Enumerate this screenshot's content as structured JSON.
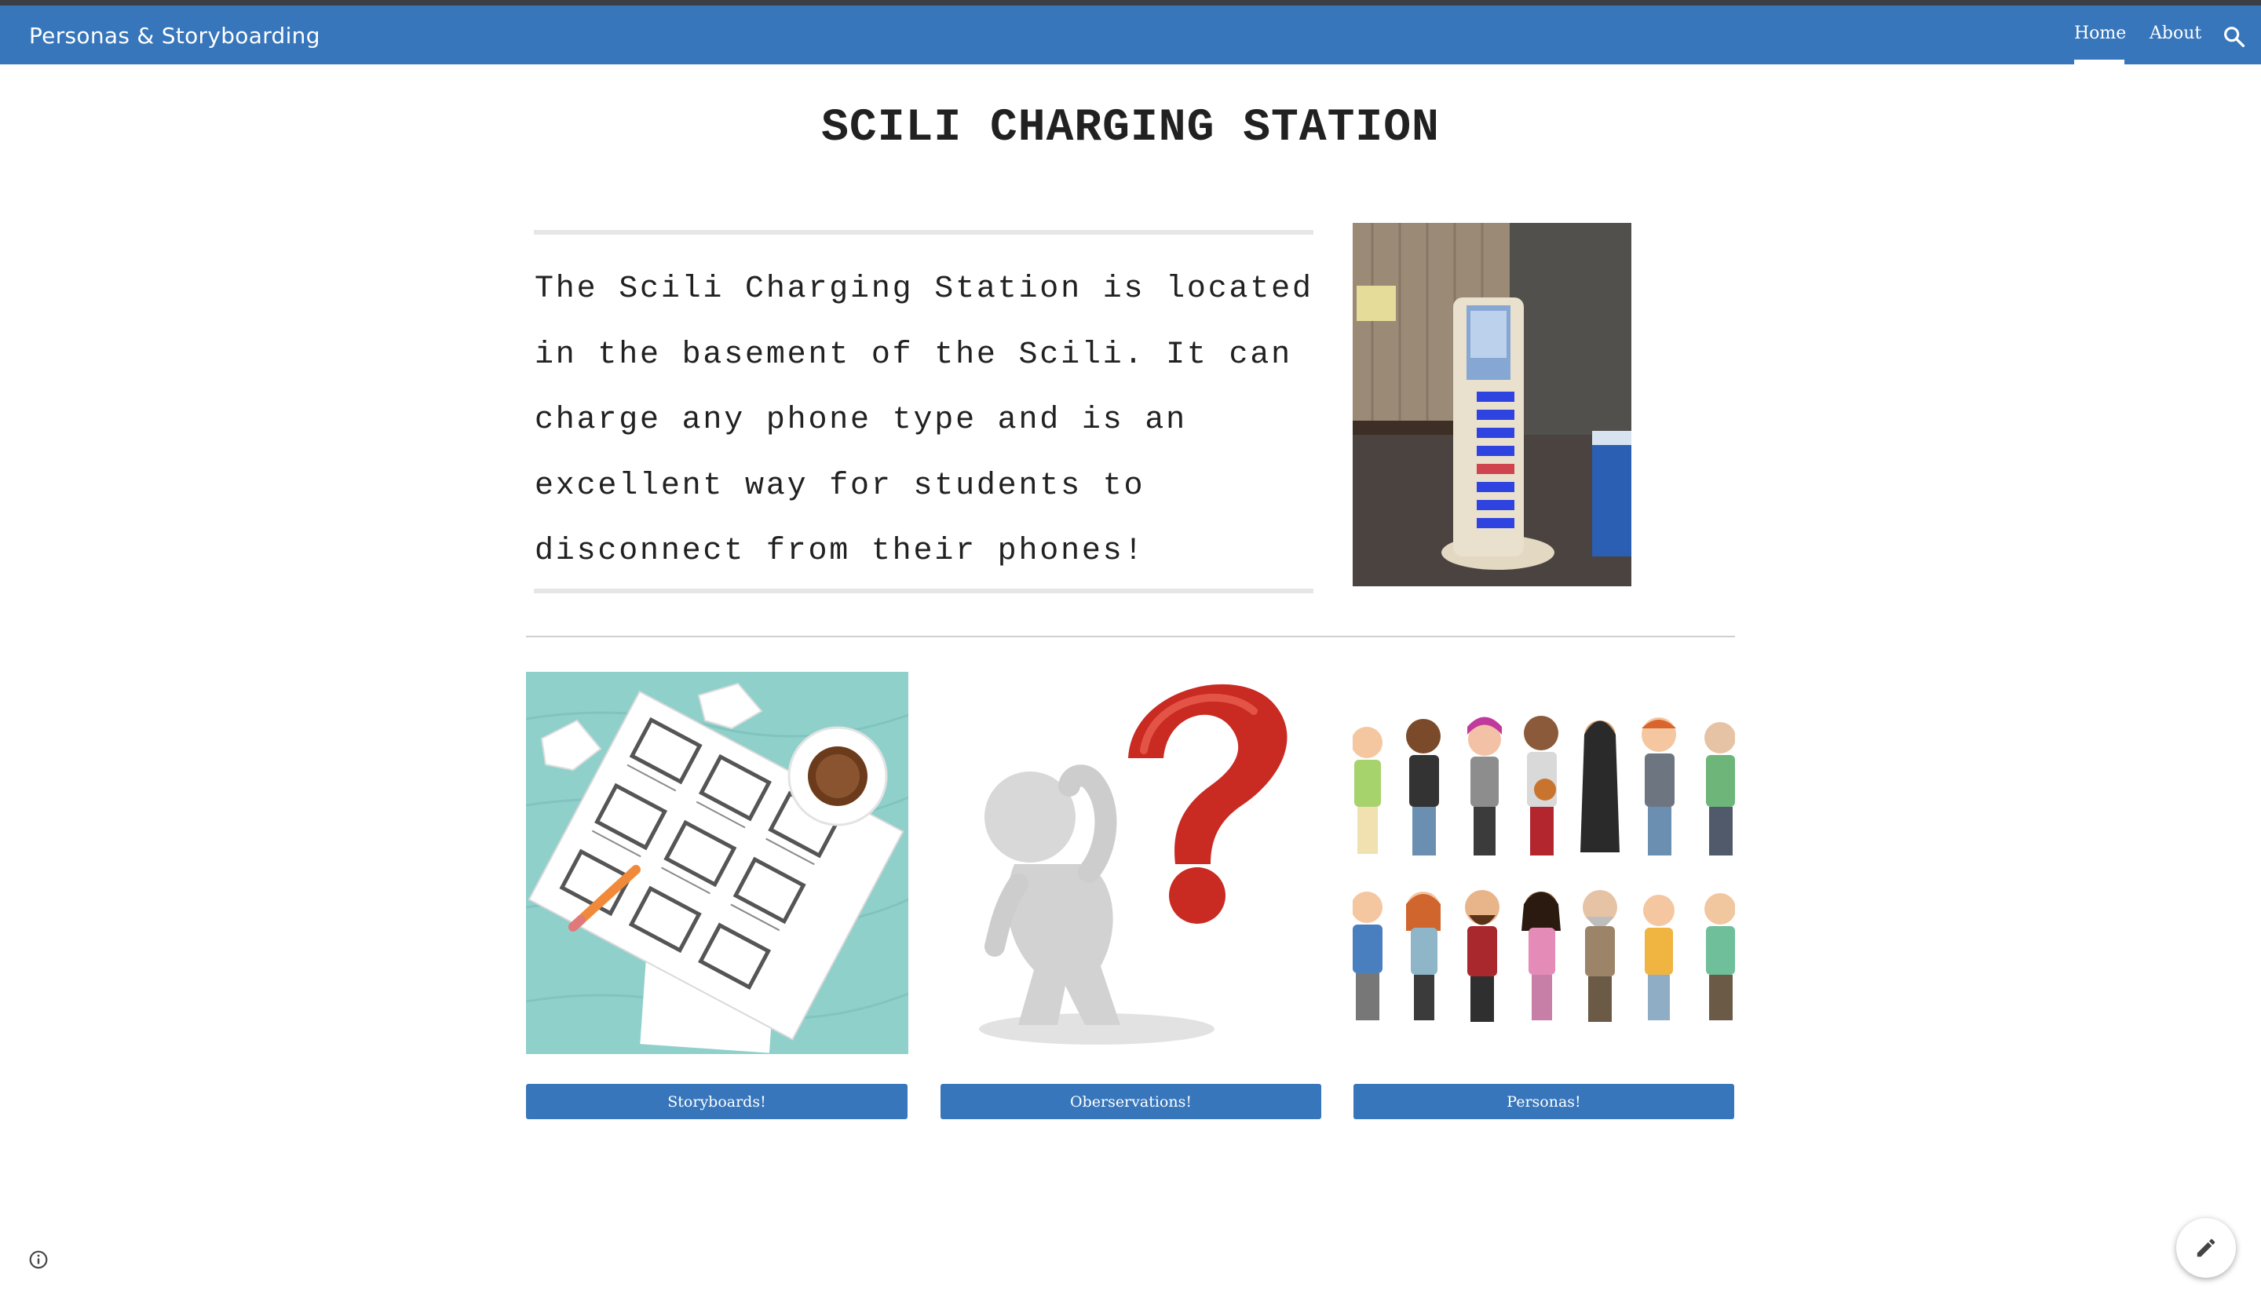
{
  "header": {
    "site_title": "Personas & Storyboarding",
    "nav": [
      {
        "label": "Home",
        "active": true
      },
      {
        "label": "About",
        "active": false
      }
    ],
    "search_icon": "search-icon",
    "accent_color": "#3776bb"
  },
  "main": {
    "title": "SCILI CHARGING STATION",
    "intro_text": "The Scili Charging Station is located in the basement of the Scili. It can charge any phone type and is an excellent way for students to disconnect from their phones!",
    "station_photo": "charging-station-photo",
    "cards": [
      {
        "image": "storyboard-illustration",
        "button_label": "Storyboards!"
      },
      {
        "image": "question-mark-figure-illustration",
        "button_label": "Oberservations!"
      },
      {
        "image": "personas-crowd-illustration",
        "button_label": "Personas!"
      }
    ]
  },
  "footer": {
    "info_icon": "info-icon",
    "edit_icon": "pencil-icon"
  }
}
